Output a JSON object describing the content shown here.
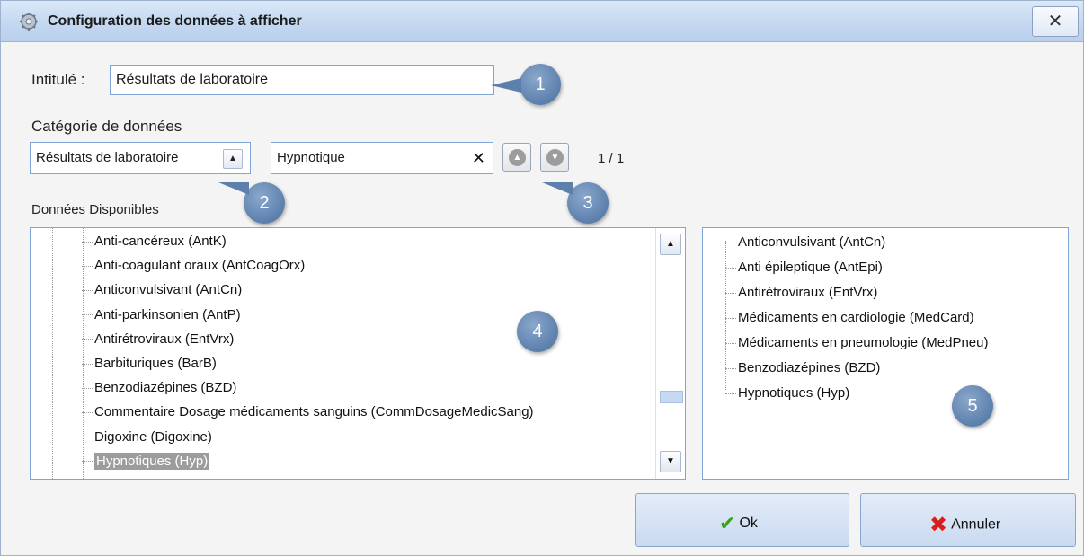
{
  "window": {
    "title": "Configuration des données à afficher",
    "close_label": "✕"
  },
  "form": {
    "intitule_label": "Intitulé :",
    "intitule_value": "Résultats de laboratoire",
    "categorie_label": "Catégorie de données",
    "categorie_value": "Résultats de laboratoire",
    "search_value": "Hypnotique",
    "match_count": "1 / 1",
    "donnees_label": "Données Disponibles"
  },
  "available_items": [
    {
      "label": "Anti-cancéreux (AntK)"
    },
    {
      "label": "Anti-coagulant oraux (AntCoagOrx)"
    },
    {
      "label": "Anticonvulsivant (AntCn)"
    },
    {
      "label": "Anti-parkinsonien (AntP)"
    },
    {
      "label": "Antirétroviraux (EntVrx)"
    },
    {
      "label": "Barbituriques (BarB)"
    },
    {
      "label": "Benzodiazépines (BZD)"
    },
    {
      "label": "Commentaire Dosage médicaments sanguins (CommDosageMedicSang)"
    },
    {
      "label": "Digoxine (Digoxine)"
    },
    {
      "label": "Hypnotiques (Hyp)",
      "selected": true
    }
  ],
  "selected_items": [
    {
      "label": "Anticonvulsivant (AntCn)"
    },
    {
      "label": "Anti épileptique (AntEpi)"
    },
    {
      "label": "Antirétroviraux (EntVrx)"
    },
    {
      "label": "Médicaments en cardiologie (MedCard)"
    },
    {
      "label": "Médicaments en pneumologie (MedPneu)"
    },
    {
      "label": "Benzodiazépines (BZD)"
    },
    {
      "label": "Hypnotiques (Hyp)"
    }
  ],
  "callouts": [
    "1",
    "2",
    "3",
    "4",
    "5"
  ],
  "buttons": {
    "ok_label": "Ok",
    "cancel_label": "Annuler"
  },
  "icons": {
    "title": "gear-icon",
    "close": "close-icon",
    "dropdown": "chevron-up-icon",
    "clear": "clear-icon",
    "prev": "up-arrow-icon",
    "next": "down-arrow-icon",
    "ok": "check-icon",
    "cancel": "cross-icon"
  },
  "colors": {
    "titlebar": "#c5d9f1",
    "callout": "#5c7fac",
    "selection": "#9c9c9c",
    "ok_icon": "#37a31d",
    "cancel_icon": "#d81e1e"
  }
}
